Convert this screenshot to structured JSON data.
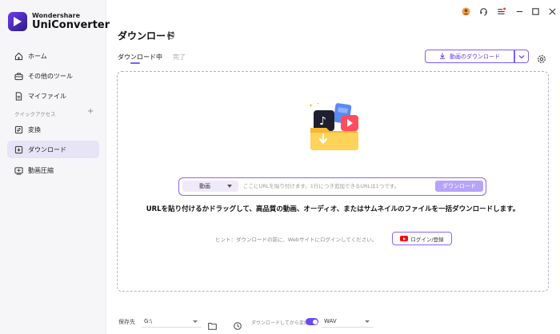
{
  "app": {
    "brand": "Wondershare",
    "name": "UniConverter"
  },
  "sidebar": {
    "items": [
      {
        "label": "ホーム",
        "icon": "home-icon"
      },
      {
        "label": "その他のツール",
        "icon": "toolbox-icon"
      },
      {
        "label": "マイファイル",
        "icon": "file-icon"
      }
    ],
    "section_label": "クイックアクセス",
    "section_plus": "+",
    "quick_items": [
      {
        "label": "変換",
        "icon": "convert-icon"
      },
      {
        "label": "ダウンロード",
        "icon": "download-icon",
        "active": true
      },
      {
        "label": "動画圧縮",
        "icon": "compress-icon"
      }
    ]
  },
  "titlebar": {
    "icons": [
      "account-icon",
      "support-icon",
      "menu-icon",
      "minimize-icon",
      "maximize-icon",
      "close-icon"
    ],
    "notification_color": "#ff3b30"
  },
  "main": {
    "title": "ダウンロード",
    "info_glyph": "i",
    "tabs": [
      {
        "label": "ダウンロード中",
        "active": true
      },
      {
        "label": "完了",
        "active": false
      }
    ],
    "download_button_label": "動画のダウンロード"
  },
  "url_bar": {
    "type_value": "動画",
    "placeholder": "ここにURLを貼り付けます。1行につき追加できるURLは1つです。",
    "download_label": "ダウンロード"
  },
  "message": "URLを貼り付けるかドラッグして、高品質の動画、オーディオ、またはサムネイルのファイルを一括ダウンロードします。",
  "hint": "ヒント：ダウンロードの前に、Webサイトにログインしてください。",
  "login_label": "ログイン/登録",
  "bottom": {
    "save_label": "保存先",
    "path_value": "G:\\",
    "convert_label": "ダウンロードしてから変換",
    "convert_enabled": true,
    "format_value": "WAV"
  },
  "colors": {
    "accent": "#7c5cff",
    "sidebar_bg": "#f6f6f8",
    "active_bg": "#e6e4f6"
  }
}
